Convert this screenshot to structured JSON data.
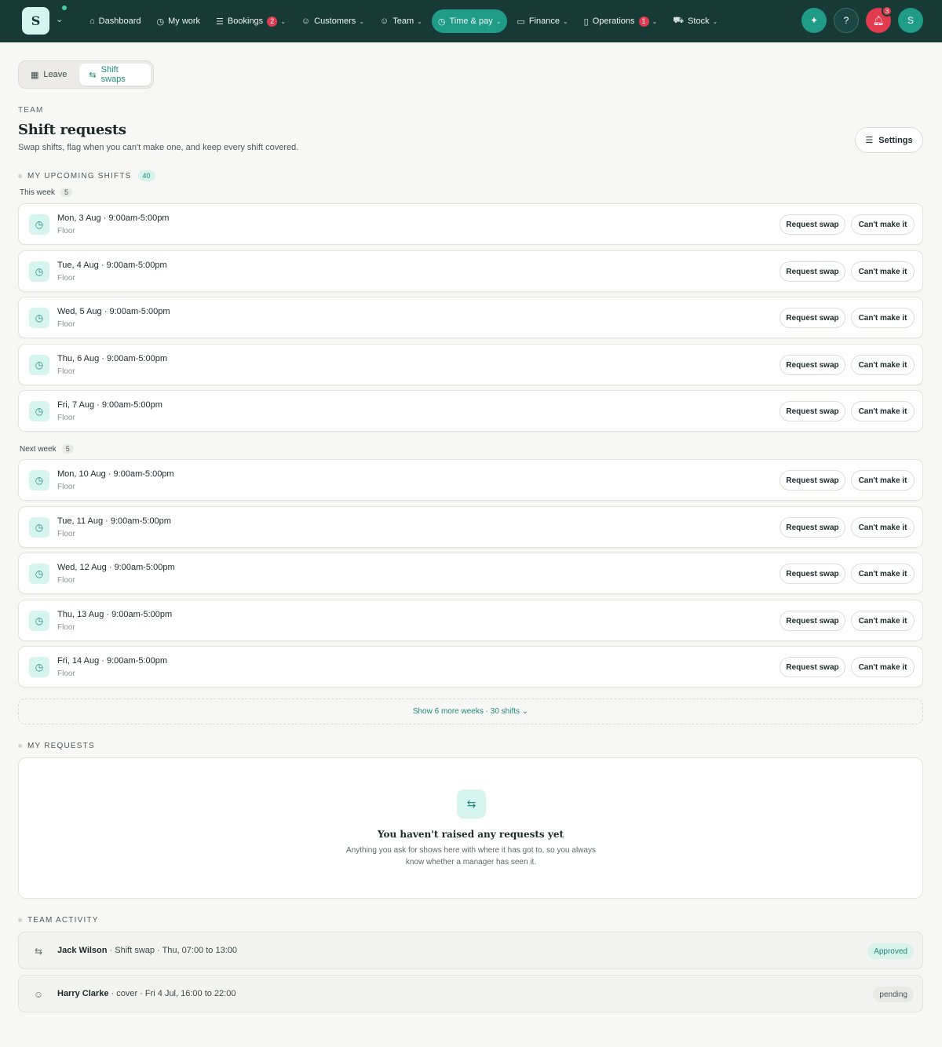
{
  "nav": {
    "logo": "S",
    "items": [
      {
        "icon": "⌂",
        "label": "Dashboard",
        "chev": false,
        "badge": ""
      },
      {
        "icon": "◷",
        "label": "My work",
        "chev": false,
        "badge": ""
      },
      {
        "icon": "☰",
        "label": "Bookings",
        "chev": true,
        "badge": "2"
      },
      {
        "icon": "☺",
        "label": "Customers",
        "chev": true,
        "badge": ""
      },
      {
        "icon": "☺",
        "label": "Team",
        "chev": true,
        "badge": ""
      },
      {
        "icon": "◷",
        "label": "Time & pay",
        "chev": true,
        "badge": "",
        "active": true
      },
      {
        "icon": "▭",
        "label": "Finance",
        "chev": true,
        "badge": ""
      },
      {
        "icon": "▯",
        "label": "Operations",
        "chev": true,
        "badge": "1"
      },
      {
        "icon": "⛟",
        "label": "Stock",
        "chev": true,
        "badge": ""
      }
    ],
    "notifications_count": "3",
    "avatar": "S"
  },
  "tabs": {
    "leave": "Leave",
    "shift_swaps": "Shift swaps"
  },
  "header": {
    "eyebrow": "TEAM",
    "title": "Shift requests",
    "subtitle": "Swap shifts, flag when you can't make one, and keep every shift covered.",
    "settings": "Settings"
  },
  "upcoming": {
    "label": "MY UPCOMING SHIFTS",
    "count": "40",
    "this_week": {
      "label": "This week",
      "count": "5"
    },
    "next_week": {
      "label": "Next week",
      "count": "5"
    },
    "shifts": [
      {
        "title": "Mon, 3 Aug · 9:00am-5:00pm",
        "location": "Floor"
      },
      {
        "title": "Tue, 4 Aug · 9:00am-5:00pm",
        "location": "Floor"
      },
      {
        "title": "Wed, 5 Aug · 9:00am-5:00pm",
        "location": "Floor"
      },
      {
        "title": "Thu, 6 Aug · 9:00am-5:00pm",
        "location": "Floor"
      },
      {
        "title": "Fri, 7 Aug · 9:00am-5:00pm",
        "location": "Floor"
      },
      {
        "title": "Mon, 10 Aug · 9:00am-5:00pm",
        "location": "Floor"
      },
      {
        "title": "Tue, 11 Aug · 9:00am-5:00pm",
        "location": "Floor"
      },
      {
        "title": "Wed, 12 Aug · 9:00am-5:00pm",
        "location": "Floor"
      },
      {
        "title": "Thu, 13 Aug · 9:00am-5:00pm",
        "location": "Floor"
      },
      {
        "title": "Fri, 14 Aug · 9:00am-5:00pm",
        "location": "Floor"
      }
    ],
    "request_swap": "Request swap",
    "cant_make_it": "Can't make it",
    "show_more": "Show 6 more weeks · 30 shifts ⌄"
  },
  "my_requests": {
    "label": "MY REQUESTS",
    "empty_title": "You haven't raised any requests yet",
    "empty_text": "Anything you ask for shows here with where it has got to, so you always know whether a manager has seen it."
  },
  "activity": {
    "label": "TEAM ACTIVITY",
    "items": [
      {
        "name": "Jack Wilson",
        "detail": " · Shift swap · Thu, 07:00 to 13:00",
        "status": "Approved"
      },
      {
        "name": "Harry Clarke",
        "detail": " · cover · Fri 4 Jul, 16:00 to 22:00",
        "status": "pending"
      }
    ]
  }
}
